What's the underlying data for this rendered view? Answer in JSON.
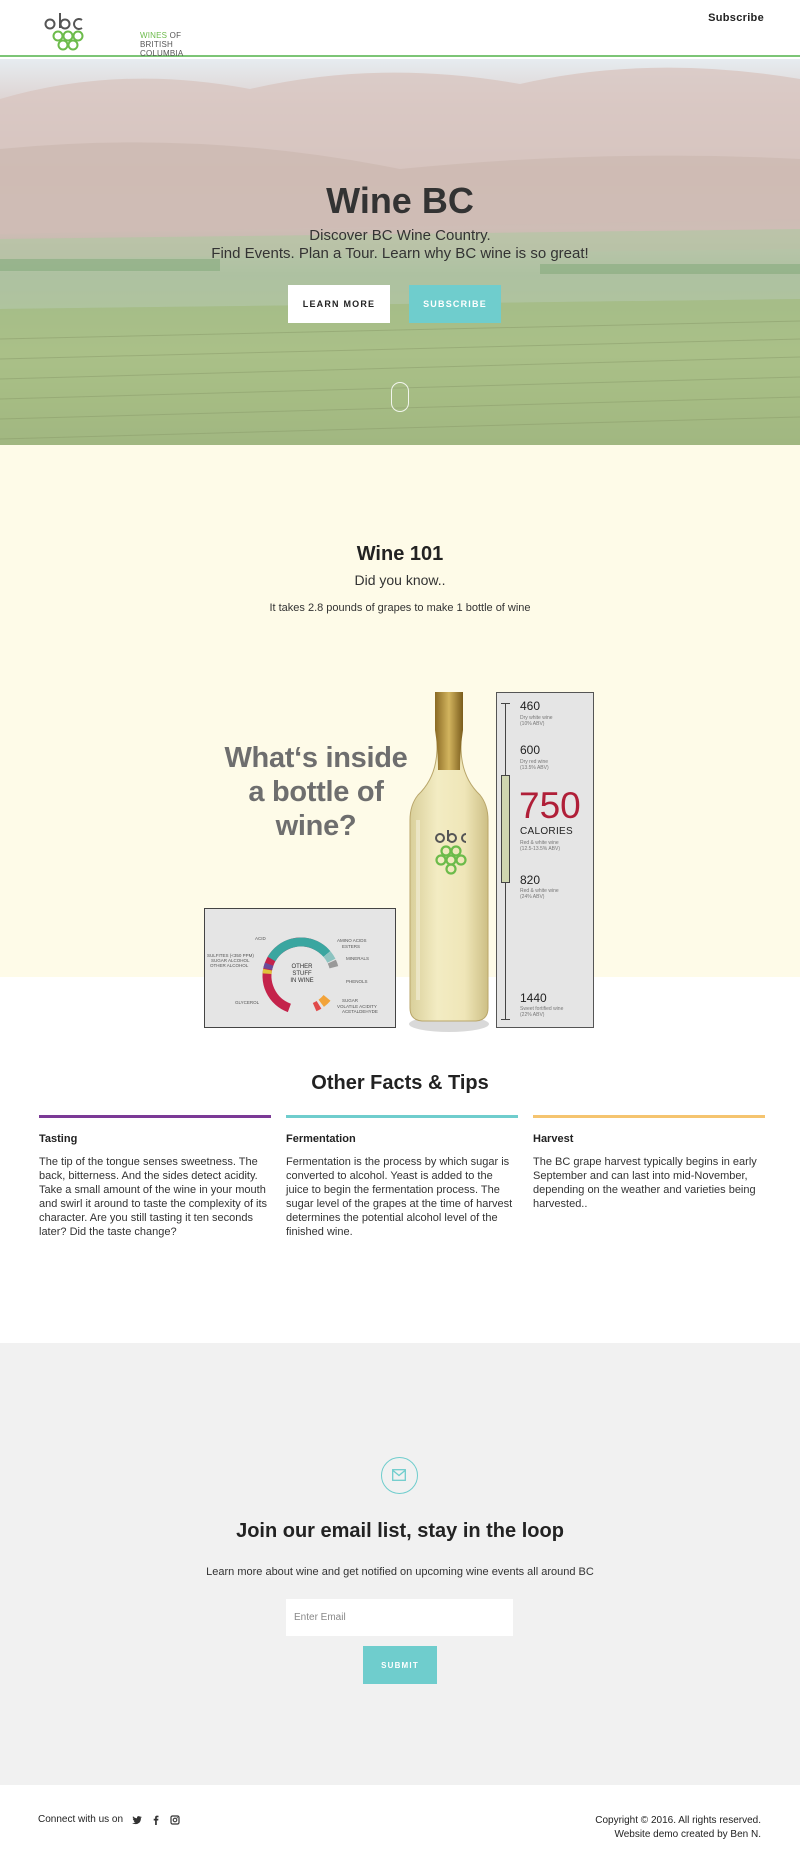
{
  "header": {
    "logo_lines": [
      "WINES OF",
      "BRITISH COLUMBIA"
    ],
    "logo_green_word": "WINES",
    "logo_rest_line1": " OF",
    "logo_line2": "BRITISH COLUMBIA",
    "nav_subscribe": "Subscribe"
  },
  "hero": {
    "title": "Wine BC",
    "subtitle_line1": "Discover BC Wine Country.",
    "subtitle_line2": "Find Events. Plan a Tour. Learn why BC wine is so great!",
    "learn_more_label": "LEARN MORE",
    "subscribe_label": "SUBSCRIBE"
  },
  "wine101": {
    "title": "Wine 101",
    "subtitle": "Did you know..",
    "fact": "It takes 2.8 pounds of grapes to make 1 bottle of wine"
  },
  "infographic": {
    "headline_line1": "What‘s inside",
    "headline_line2": "a bottle of wine?",
    "donut_center": [
      "OTHER",
      "STUFF",
      "IN WINE"
    ],
    "donut_labels_left": [
      "ACID",
      "SULFITES (<350 PPM)",
      "SUGAR ALCOHOL",
      "OTHER ALCOHOL",
      "GLYCEROL"
    ],
    "donut_labels_right": [
      "AMINO ACIDS",
      "ESTERS",
      "MINERALS",
      "PHENOLS",
      "SUGAR",
      "VOLATILE ACIDITY",
      "ACETALDEHYDE"
    ],
    "calories": [
      {
        "value": "460",
        "note1": "Dry white wine",
        "note2": "(10% ABV)"
      },
      {
        "value": "600",
        "note1": "Dry red wine",
        "note2": "(13.5% ABV)"
      },
      {
        "value": "820",
        "note1": "Red & white wine",
        "note2": "(24% ABV)"
      },
      {
        "value": "1440",
        "note1": "Sweet fortified wine",
        "note2": "(22% ABV)"
      }
    ],
    "cal_big": "750",
    "cal_unit": "CALORIES",
    "cal_big_note1": "Red & white wine",
    "cal_big_note2": "(12.5-13.5% ABV)",
    "colors": {
      "donut_teal": "#3aa6a0",
      "donut_red": "#c4234b",
      "calorie_red": "#b01f38"
    }
  },
  "facts": {
    "title": "Other Facts & Tips",
    "items": [
      {
        "heading": "Tasting",
        "color": "#7b3a96",
        "text": "The tip of the tongue senses sweetness. The back, bitterness. And the sides detect acidity. Take a small amount of the wine in your mouth and swirl it around to taste the complexity of its character. Are you still tasting it ten seconds later? Did the taste change?"
      },
      {
        "heading": "Fermentation",
        "color": "#6fcdcd",
        "text": "Fermentation is the process by which sugar is converted to alcohol. Yeast is added to the juice to begin the fermentation process. The sugar level of the grapes at the time of harvest determines the potential alcohol level of the finished wine."
      },
      {
        "heading": "Harvest",
        "color": "#f5c46f",
        "text": "The BC grape harvest typically begins in early September and can last into mid-November, depending on the weather and varieties being harvested.."
      }
    ]
  },
  "email": {
    "icon": "mail-icon",
    "title": "Join our email list, stay in the loop",
    "subtitle": "Learn more about wine and get notified on upcoming wine events all around BC",
    "placeholder": "Enter Email",
    "submit_label": "SUBMIT"
  },
  "footer": {
    "connect_label": "Connect with us on",
    "social_icons": [
      "twitter-icon",
      "facebook-icon",
      "instagram-icon"
    ],
    "copyright": "Copyright © 2016. All rights reserved.",
    "credit": "Website demo created by Ben N."
  },
  "colors": {
    "accent_teal": "#6fcdcd",
    "green_rule": "#7cc576",
    "cream_bg": "#fefbe8",
    "email_bg": "#f1f1f1"
  }
}
